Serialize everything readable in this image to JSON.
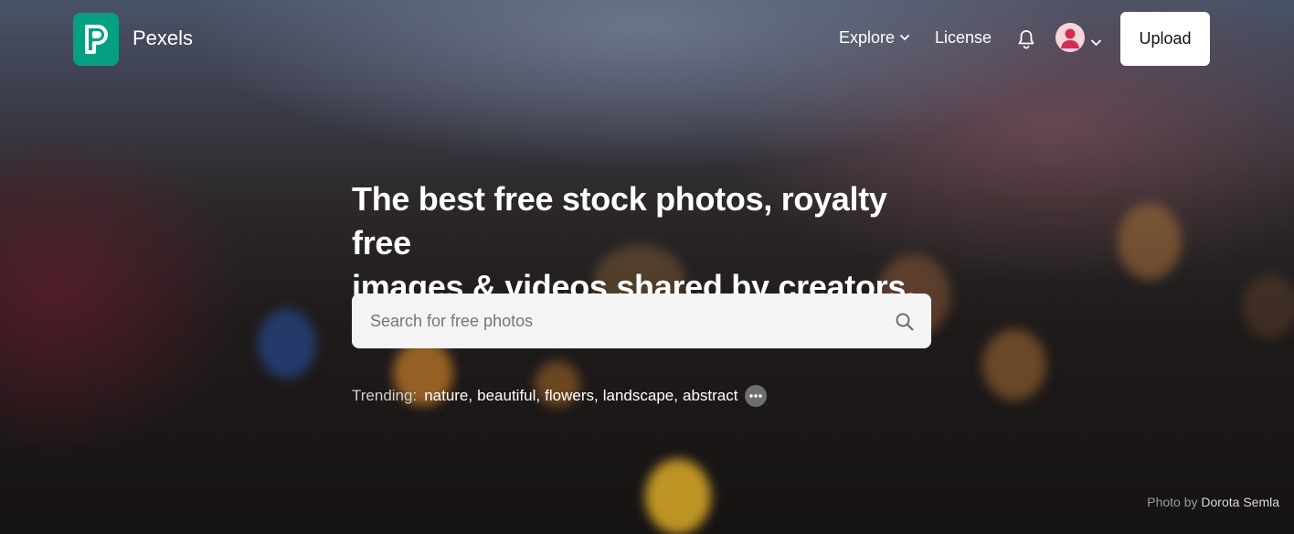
{
  "brand": {
    "name": "Pexels",
    "logo_letter": "P",
    "logo_color": "#05a081"
  },
  "nav": {
    "explore_label": "Explore",
    "license_label": "License",
    "upload_label": "Upload"
  },
  "hero": {
    "headline_line1": "The best free stock photos, royalty free",
    "headline_line2": "images & videos shared by creators."
  },
  "search": {
    "placeholder": "Search for free photos",
    "value": ""
  },
  "trending": {
    "label": "Trending:",
    "terms": [
      "nature",
      "beautiful",
      "flowers",
      "landscape",
      "abstract"
    ]
  },
  "credit": {
    "prefix": "Photo by",
    "author": "Dorota Semla"
  },
  "icons": {
    "explore_chevron": "chevron-down-icon",
    "bell": "bell-icon",
    "avatar": "user-avatar-icon",
    "search": "search-icon",
    "more": "more-dots-icon"
  }
}
